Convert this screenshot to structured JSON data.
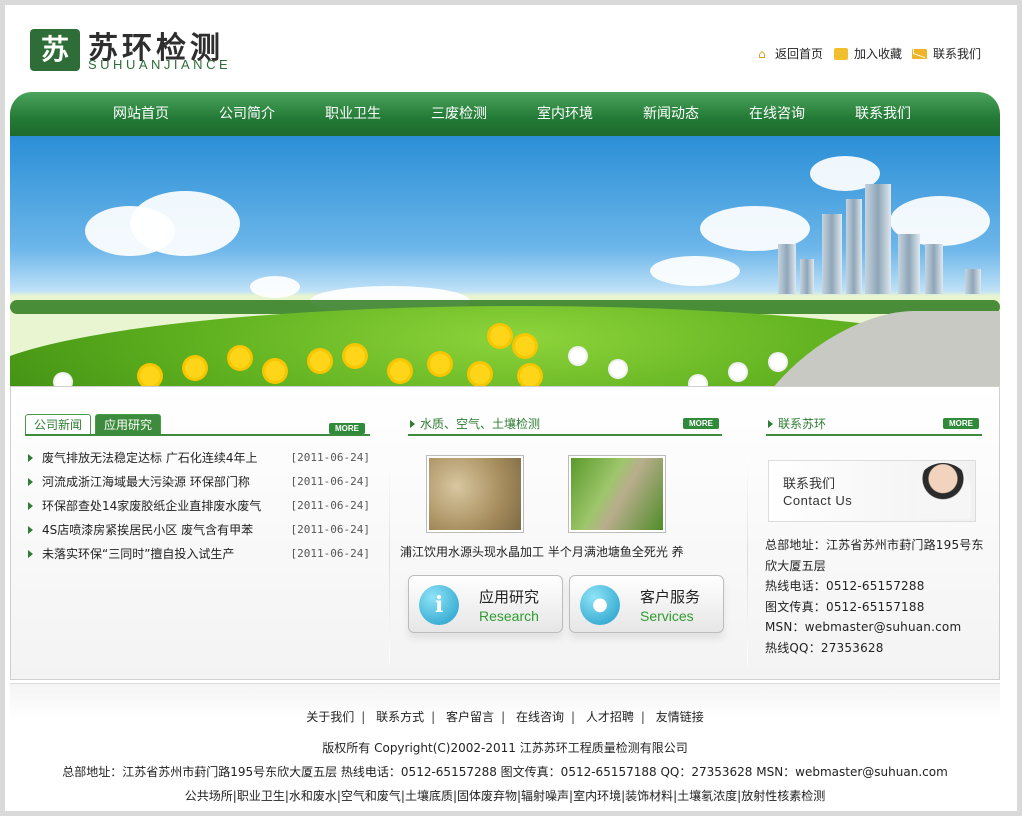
{
  "header": {
    "logo_mark": "苏",
    "logo_cn": "苏环检测",
    "logo_en": "SUHUANJIANCE",
    "links": [
      {
        "label": "返回首页",
        "icon": "home-icon"
      },
      {
        "label": "加入收藏",
        "icon": "lock-icon"
      },
      {
        "label": "联系我们",
        "icon": "mail-icon"
      }
    ]
  },
  "nav": [
    "网站首页",
    "公司简介",
    "职业卫生",
    "三废检测",
    "室内环境",
    "新闻动态",
    "在线咨询",
    "联系我们"
  ],
  "news": {
    "tabs": [
      "公司新闻",
      "应用研究"
    ],
    "more": "MORE",
    "items": [
      {
        "title": "废气排放无法稳定达标 广石化连续4年上",
        "date": "[2011-06-24]"
      },
      {
        "title": "河流成浙江海域最大污染源 环保部门称",
        "date": "[2011-06-24]"
      },
      {
        "title": "环保部查处14家废胶纸企业直排废水废气",
        "date": "[2011-06-24]"
      },
      {
        "title": "4S店喷漆房紧挨居民小区 废气含有甲苯",
        "date": "[2011-06-24]"
      },
      {
        "title": "未落实环保“三同时”擅自投入试生产",
        "date": "[2011-06-24]"
      }
    ]
  },
  "testing": {
    "title": "水质、空气、土壤检测",
    "more": "MORE",
    "scroll_text": "浦江饮用水源头现水晶加工 半个月满池塘鱼全死光  养",
    "services": [
      {
        "cn": "应用研究",
        "en": "Research",
        "icon": "info-icon"
      },
      {
        "cn": "客户服务",
        "en": "Services",
        "icon": "user-icon"
      }
    ]
  },
  "contact": {
    "title": "联系苏环",
    "more": "MORE",
    "card_cn": "联系我们",
    "card_en": "Contact Us",
    "lines": [
      "总部地址：江苏省苏州市葑门路195号东欣大厦五层",
      "热线电话：0512-65157288",
      "图文传真：0512-65157188",
      "MSN：webmaster@suhuan.com",
      "热线QQ：27353628"
    ]
  },
  "footer": {
    "links": [
      "关于我们",
      "联系方式",
      "客户留言",
      "在线咨询",
      "人才招聘",
      "友情链接"
    ],
    "copyright": "版权所有  Copyright(C)2002-2011 江苏苏环工程质量检测有限公司",
    "address": "总部地址：江苏省苏州市葑门路195号东欣大厦五层  热线电话：0512-65157288  图文传真：0512-65157188  QQ：27353628  MSN：webmaster@suhuan.com",
    "services": "公共场所|职业卫生|水和废水|空气和废气|土壤底质|固体废弃物|辐射噪声|室内环境|装饰材料|土壤氡浓度|放射性核素检测"
  },
  "colors": {
    "brand_green": "#237a36",
    "accent": "#2e7d32"
  }
}
